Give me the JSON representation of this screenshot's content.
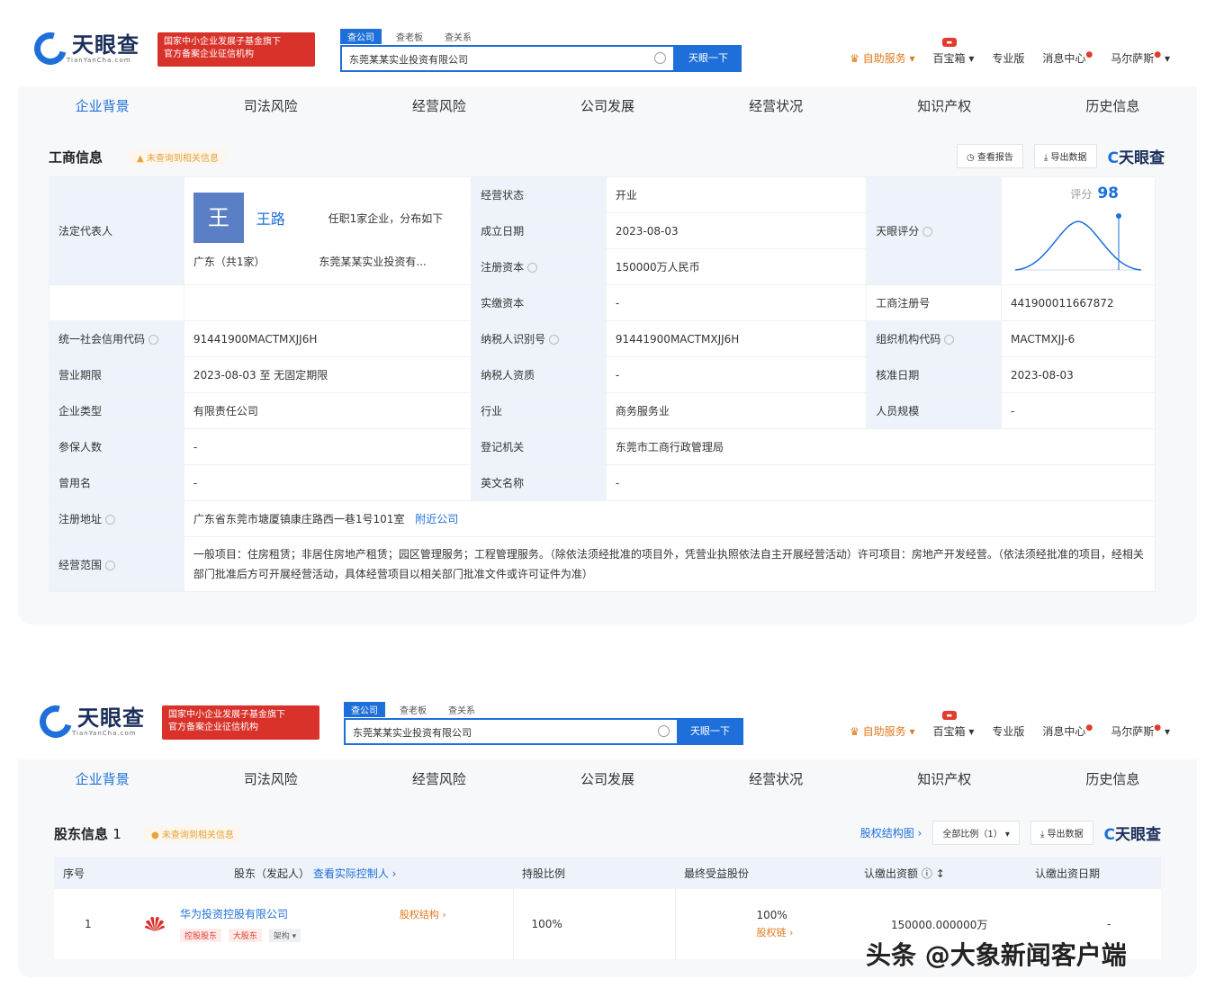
{
  "brand": {
    "name": "天眼查",
    "sub": "TianYanCha.com",
    "badge_line1": "国家中小企业发展子基金旗下",
    "badge_line2": "官方备案企业征信机构"
  },
  "search": {
    "tabs": [
      "查公司",
      "查老板",
      "查关系"
    ],
    "value": "东莞某某实业投资有限公司",
    "button": "天眼一下"
  },
  "topnav": {
    "self_service": "自助服务",
    "baobox": "百宝箱",
    "pro": "专业版",
    "messages": "消息中心",
    "user": "马尔萨斯"
  },
  "tabs": [
    "企业背景",
    "司法风险",
    "经营风险",
    "公司发展",
    "经营状况",
    "知识产权",
    "历史信息"
  ],
  "business_info": {
    "title": "工商信息",
    "note": "未查询到相关信息",
    "actions": {
      "report": "查看报告",
      "export": "导出数据"
    },
    "legal_rep_label": "法定代表人",
    "rep_initial": "王",
    "rep_name": "王路",
    "rep_positions": "任职1家企业，分布如下",
    "rep_region": "广东（共1家）",
    "rep_company": "东莞某某实业投资有...",
    "fields": {
      "status_k": "经营状态",
      "status_v": "开业",
      "founded_k": "成立日期",
      "founded_v": "2023-08-03",
      "capital_k": "注册资本",
      "capital_v": "150000万人民币",
      "paid_k": "实缴资本",
      "paid_v": "-",
      "score_k": "天眼评分",
      "score_label": "评分",
      "score_v": "98",
      "reg_no_k": "工商注册号",
      "reg_no_v": "441900011667872",
      "credit_k": "统一社会信用代码",
      "credit_v": "91441900MACTMXJJ6H",
      "taxid_k": "纳税人识别号",
      "taxid_v": "91441900MACTMXJJ6H",
      "org_k": "组织机构代码",
      "org_v": "MACTMXJJ-6",
      "term_k": "营业期限",
      "term_v": "2023-08-03 至 无固定期限",
      "taxq_k": "纳税人资质",
      "taxq_v": "-",
      "approved_k": "核准日期",
      "approved_v": "2023-08-03",
      "type_k": "企业类型",
      "type_v": "有限责任公司",
      "industry_k": "行业",
      "industry_v": "商务服务业",
      "staff_k": "人员规模",
      "staff_v": "-",
      "insured_k": "参保人数",
      "insured_v": "-",
      "authority_k": "登记机关",
      "authority_v": "东莞市工商行政管理局",
      "former_k": "曾用名",
      "former_v": "-",
      "en_k": "英文名称",
      "en_v": "-",
      "addr_k": "注册地址",
      "addr_v": "广东省东莞市塘厦镇康庄路西一巷1号101室",
      "addr_link": "附近公司",
      "scope_k": "经营范围",
      "scope_v": "一般项目：住房租赁；非居住房地产租赁；园区管理服务；工程管理服务。（除依法须经批准的项目外，凭营业执照依法自主开展经营活动）许可项目：房地产开发经营。（依法须经批准的项目，经相关部门批准后方可开展经营活动，具体经营项目以相关部门批准文件或许可证件为准）"
    }
  },
  "shareholders": {
    "title": "股东信息",
    "count": "1",
    "note": "未查询到相关信息",
    "structure_link": "股权结构图",
    "filter": "全部比例（1）",
    "export": "导出数据",
    "columns": [
      "序号",
      "股东（发起人）",
      "持股比例",
      "最终受益股份",
      "认缴出资额",
      "认缴出资日期"
    ],
    "beneficiary_link": "查看实际控制人",
    "rows": [
      {
        "index": "1",
        "name": "华为投资控股有限公司",
        "equity_link": "股权结构",
        "tags": [
          "控股股东",
          "大股东",
          "架构"
        ],
        "ratio": "100%",
        "final_benefit": "100%",
        "path_link": "股权链",
        "amount": "150000.000000万",
        "date": "-"
      }
    ]
  },
  "watermark": "头条 @大象新闻客户端",
  "colors": {
    "primary": "#1e6fd9",
    "badge_red": "#d8322b",
    "accent_orange": "#e07a1f"
  }
}
